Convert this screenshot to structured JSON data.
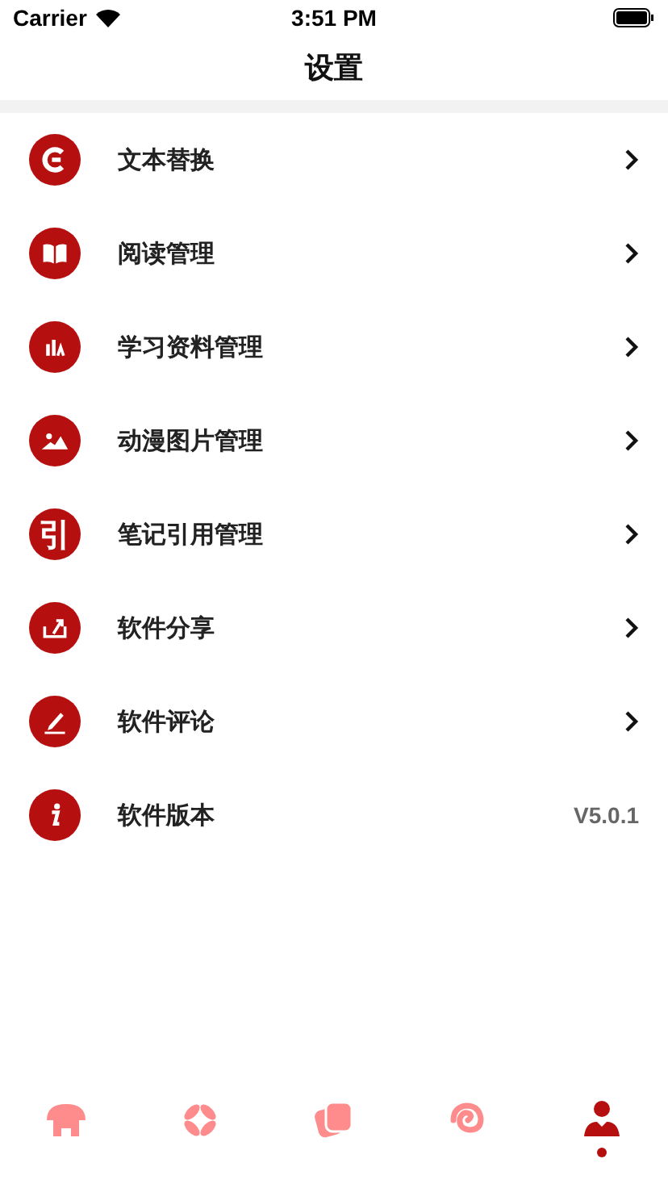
{
  "status_bar": {
    "carrier": "Carrier",
    "time": "3:51 PM"
  },
  "title": "设置",
  "items": [
    {
      "label": "文本替换",
      "kind": "link"
    },
    {
      "label": "阅读管理",
      "kind": "link"
    },
    {
      "label": "学习资料管理",
      "kind": "link"
    },
    {
      "label": "动漫图片管理",
      "kind": "link"
    },
    {
      "glyph": "引",
      "label": "笔记引用管理",
      "kind": "link"
    },
    {
      "label": "软件分享",
      "kind": "link"
    },
    {
      "label": "软件评论",
      "kind": "link"
    },
    {
      "label": "软件版本",
      "kind": "value",
      "value": "V5.0.1"
    }
  ],
  "tabs": [
    {
      "selected": false
    },
    {
      "selected": false
    },
    {
      "selected": false
    },
    {
      "selected": false
    },
    {
      "selected": true
    }
  ]
}
